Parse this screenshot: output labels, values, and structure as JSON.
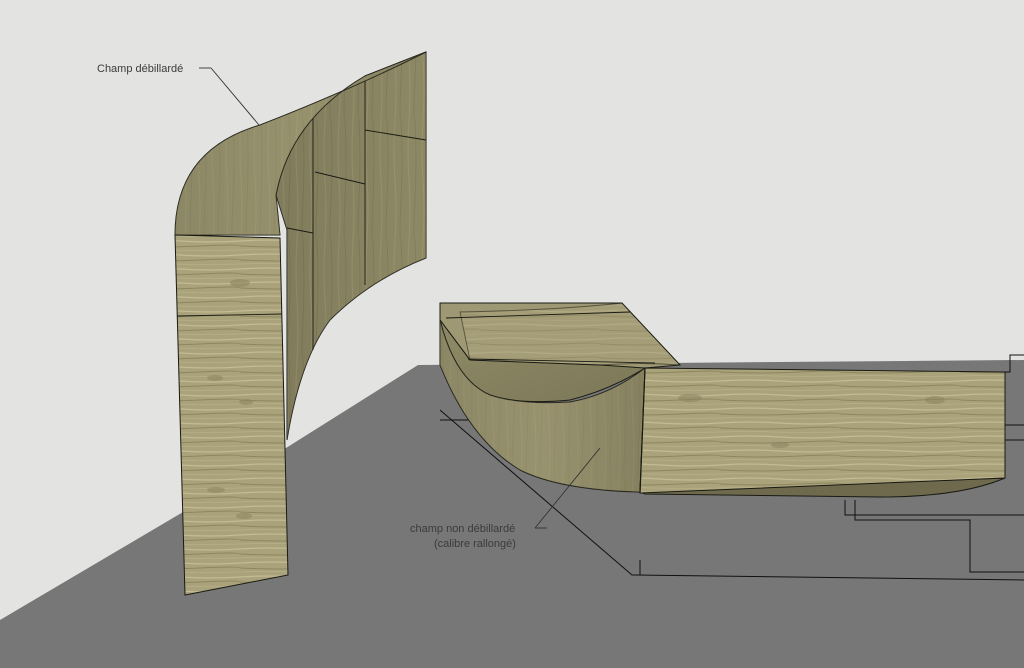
{
  "annotations": {
    "top_label": "Champ débillardé",
    "bottom_label_line1": "champ non débillardé",
    "bottom_label_line2": "(calibre rallongé)"
  },
  "colors": {
    "sky": "#e3e3e1",
    "ground": "#777777",
    "wood_light": "#aaa27a",
    "wood_mid": "#8f8a66",
    "wood_dark": "#6e6a4e",
    "edge": "#1a1a14",
    "label_text": "#3b3b3b"
  }
}
